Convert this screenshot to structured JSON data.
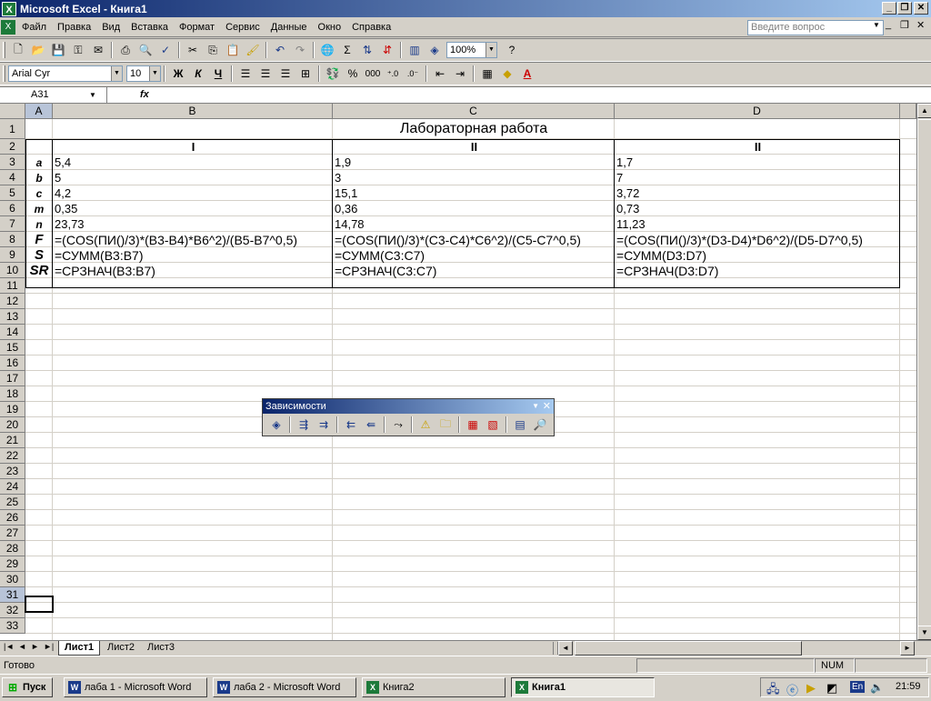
{
  "window": {
    "title": "Microsoft Excel - Книга1",
    "app_icon": "excel-icon"
  },
  "menu": {
    "items": [
      "Файл",
      "Правка",
      "Вид",
      "Вставка",
      "Формат",
      "Сервис",
      "Данные",
      "Окно",
      "Справка"
    ],
    "help_placeholder": "Введите вопрос"
  },
  "toolbar": {
    "zoom": "100%",
    "font": "Arial Cyr",
    "size": "10",
    "bold": "Ж",
    "italic": "К",
    "underline": "Ч",
    "percent": "%",
    "thousands": "000"
  },
  "formula_bar": {
    "name_box": "A31",
    "fx": "fx",
    "content": ""
  },
  "columns": [
    "A",
    "B",
    "C",
    "D"
  ],
  "rows": [
    "1",
    "2",
    "3",
    "4",
    "5",
    "6",
    "7",
    "8",
    "9",
    "10",
    "11",
    "12",
    "13",
    "14",
    "15",
    "16",
    "17",
    "18",
    "19",
    "20",
    "21",
    "22",
    "23",
    "24",
    "25",
    "26",
    "27",
    "28",
    "29",
    "30",
    "31",
    "32",
    "33"
  ],
  "sheet": {
    "title": "Лабораторная работа",
    "headers": {
      "b": "I",
      "c": "II",
      "d": "II"
    },
    "rows": [
      {
        "label": "a",
        "b": "5,4",
        "c": "1,9",
        "d": "1,7"
      },
      {
        "label": "b",
        "b": "5",
        "c": "3",
        "d": "7"
      },
      {
        "label": "c",
        "b": "4,2",
        "c": "15,1",
        "d": "3,72"
      },
      {
        "label": "m",
        "b": "0,35",
        "c": "0,36",
        "d": "0,73"
      },
      {
        "label": "n",
        "b": "23,73",
        "c": "14,78",
        "d": "11,23"
      },
      {
        "label": "F",
        "b": "=(COS(ПИ()/3)*(B3-B4)*B6^2)/(B5-B7^0,5)",
        "c": "=(COS(ПИ()/3)*(C3-C4)*C6^2)/(C5-C7^0,5)",
        "d": "=(COS(ПИ()/3)*(D3-D4)*D6^2)/(D5-D7^0,5)"
      },
      {
        "label": "S",
        "b": "=СУММ(B3:B7)",
        "c": "=СУММ(C3:C7)",
        "d": "=СУММ(D3:D7)"
      },
      {
        "label": "SR",
        "b": "=СРЗНАЧ(B3:B7)",
        "c": "=СРЗНАЧ(C3:C7)",
        "d": "=СРЗНАЧ(D3:D7)"
      }
    ]
  },
  "float_toolbar": {
    "title": "Зависимости"
  },
  "sheet_tabs": [
    "Лист1",
    "Лист2",
    "Лист3"
  ],
  "status": {
    "left": "Готово",
    "num": "NUM"
  },
  "taskbar": {
    "start": "Пуск",
    "tasks": [
      "лаба 1 - Microsoft Word",
      "лаба 2 - Microsoft Word",
      "Книга2",
      "Книга1"
    ],
    "lang": "En",
    "time": "21:59"
  }
}
